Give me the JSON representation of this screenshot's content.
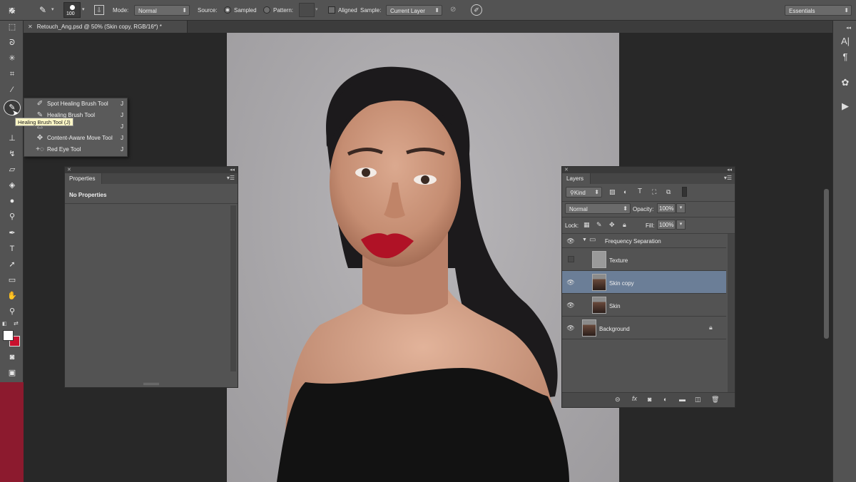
{
  "options_bar": {
    "brush_size": "100",
    "mode_label": "Mode:",
    "mode_value": "Normal",
    "source_label": "Source:",
    "source_sampled": "Sampled",
    "source_pattern": "Pattern:",
    "aligned_label": "Aligned",
    "sample_label": "Sample:",
    "sample_value": "Current Layer",
    "workspace": "Essentials"
  },
  "document_tab": {
    "title": "Retouch_Ang.psd @ 50% (Skin copy, RGB/16*) *"
  },
  "tool_flyout": {
    "items": [
      {
        "label": "Spot Healing Brush Tool",
        "shortcut": "J"
      },
      {
        "label": "Healing Brush Tool",
        "shortcut": "J"
      },
      {
        "label": "",
        "shortcut": "J"
      },
      {
        "label": "Content-Aware Move Tool",
        "shortcut": "J"
      },
      {
        "label": "Red Eye Tool",
        "shortcut": "J"
      }
    ],
    "tooltip": "Healing Brush Tool (J)"
  },
  "properties_panel": {
    "tab": "Properties",
    "content": "No Properties"
  },
  "layers_panel": {
    "tab": "Layers",
    "filter_kind": "Kind",
    "blend_mode": "Normal",
    "opacity_label": "Opacity:",
    "opacity_value": "100%",
    "lock_label": "Lock:",
    "fill_label": "Fill:",
    "fill_value": "100%",
    "layers": [
      {
        "name": "Frequency Separation",
        "type": "group",
        "visible": true,
        "selected": false
      },
      {
        "name": "Texture",
        "type": "layer",
        "visible": false,
        "selected": false
      },
      {
        "name": "Skin copy",
        "type": "layer",
        "visible": true,
        "selected": true
      },
      {
        "name": "Skin",
        "type": "layer",
        "visible": true,
        "selected": false
      },
      {
        "name": "Background",
        "type": "layer",
        "visible": true,
        "selected": false,
        "locked": true
      }
    ]
  },
  "colors": {
    "foreground": "#ffffff",
    "background": "#c8102e",
    "selection": "#6b7e97"
  }
}
